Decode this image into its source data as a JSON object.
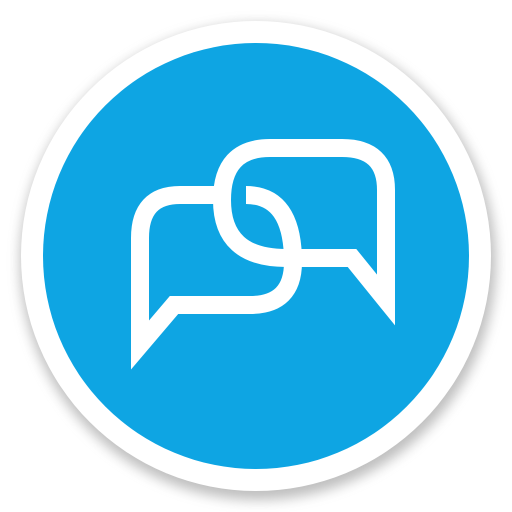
{
  "icon": {
    "name": "chat-bubbles-icon",
    "colors": {
      "badge_fill": "#0ea5e3",
      "badge_ring": "#ffffff",
      "glyph": "#ffffff",
      "shadow": "#8a8a8a"
    }
  }
}
